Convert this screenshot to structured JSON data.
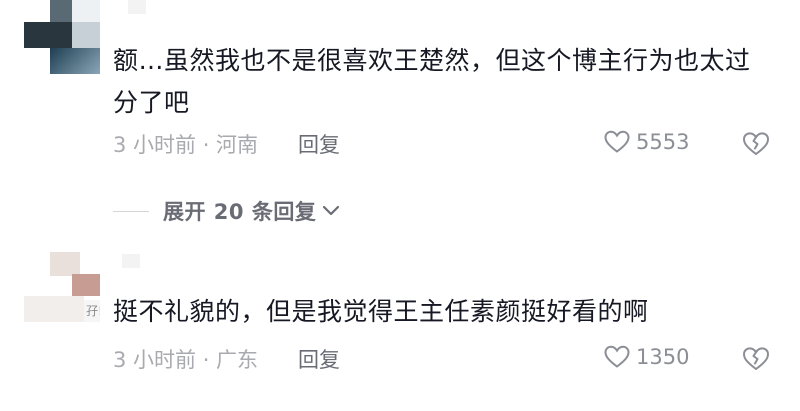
{
  "comments": [
    {
      "text": "额…虽然我也不是很喜欢王楚然，但这个博主行为也太过分了吧",
      "time_location": "3 小时前 · 河南",
      "reply_label": "回复",
      "likes": "5553"
    },
    {
      "text": "挺不礼貌的，但是我觉得王主任素颜挺好看的啊",
      "time_location": "3 小时前 · 广东",
      "reply_label": "回复",
      "likes": "1350",
      "avatar_fragment_text": "孖!"
    }
  ],
  "expand_replies": {
    "label": "展开 20 条回复"
  },
  "colors": {
    "text": "#161823",
    "meta": "#a9aab0",
    "reply": "#6a6c75"
  }
}
